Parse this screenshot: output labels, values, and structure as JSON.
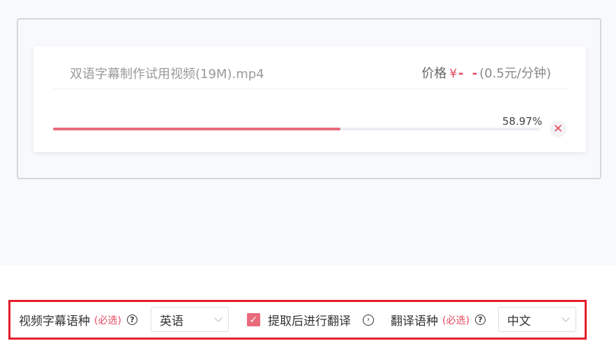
{
  "file": {
    "name": "双语字幕制作试用视频(19M).mp4",
    "price_label": "价格",
    "currency_symbol": "¥",
    "price_value": "- -",
    "rate": "(0.5元/分钟)",
    "progress_percent_text": "58.97%",
    "progress_fraction": 0.5897,
    "cancel_icon": "close-icon"
  },
  "options": {
    "video_language_label": "视频字幕语种",
    "required_text_1": "(必选)",
    "video_language_value": "英语",
    "translate_checkbox_label": "提取后进行翻译",
    "translate_checked": true,
    "translation_language_label": "翻译语种",
    "required_text_2": "(必选)",
    "translation_language_value": "中文"
  },
  "colors": {
    "accent": "#e96a7b",
    "price": "#e5485b",
    "highlight_border": "#e51d2a"
  }
}
